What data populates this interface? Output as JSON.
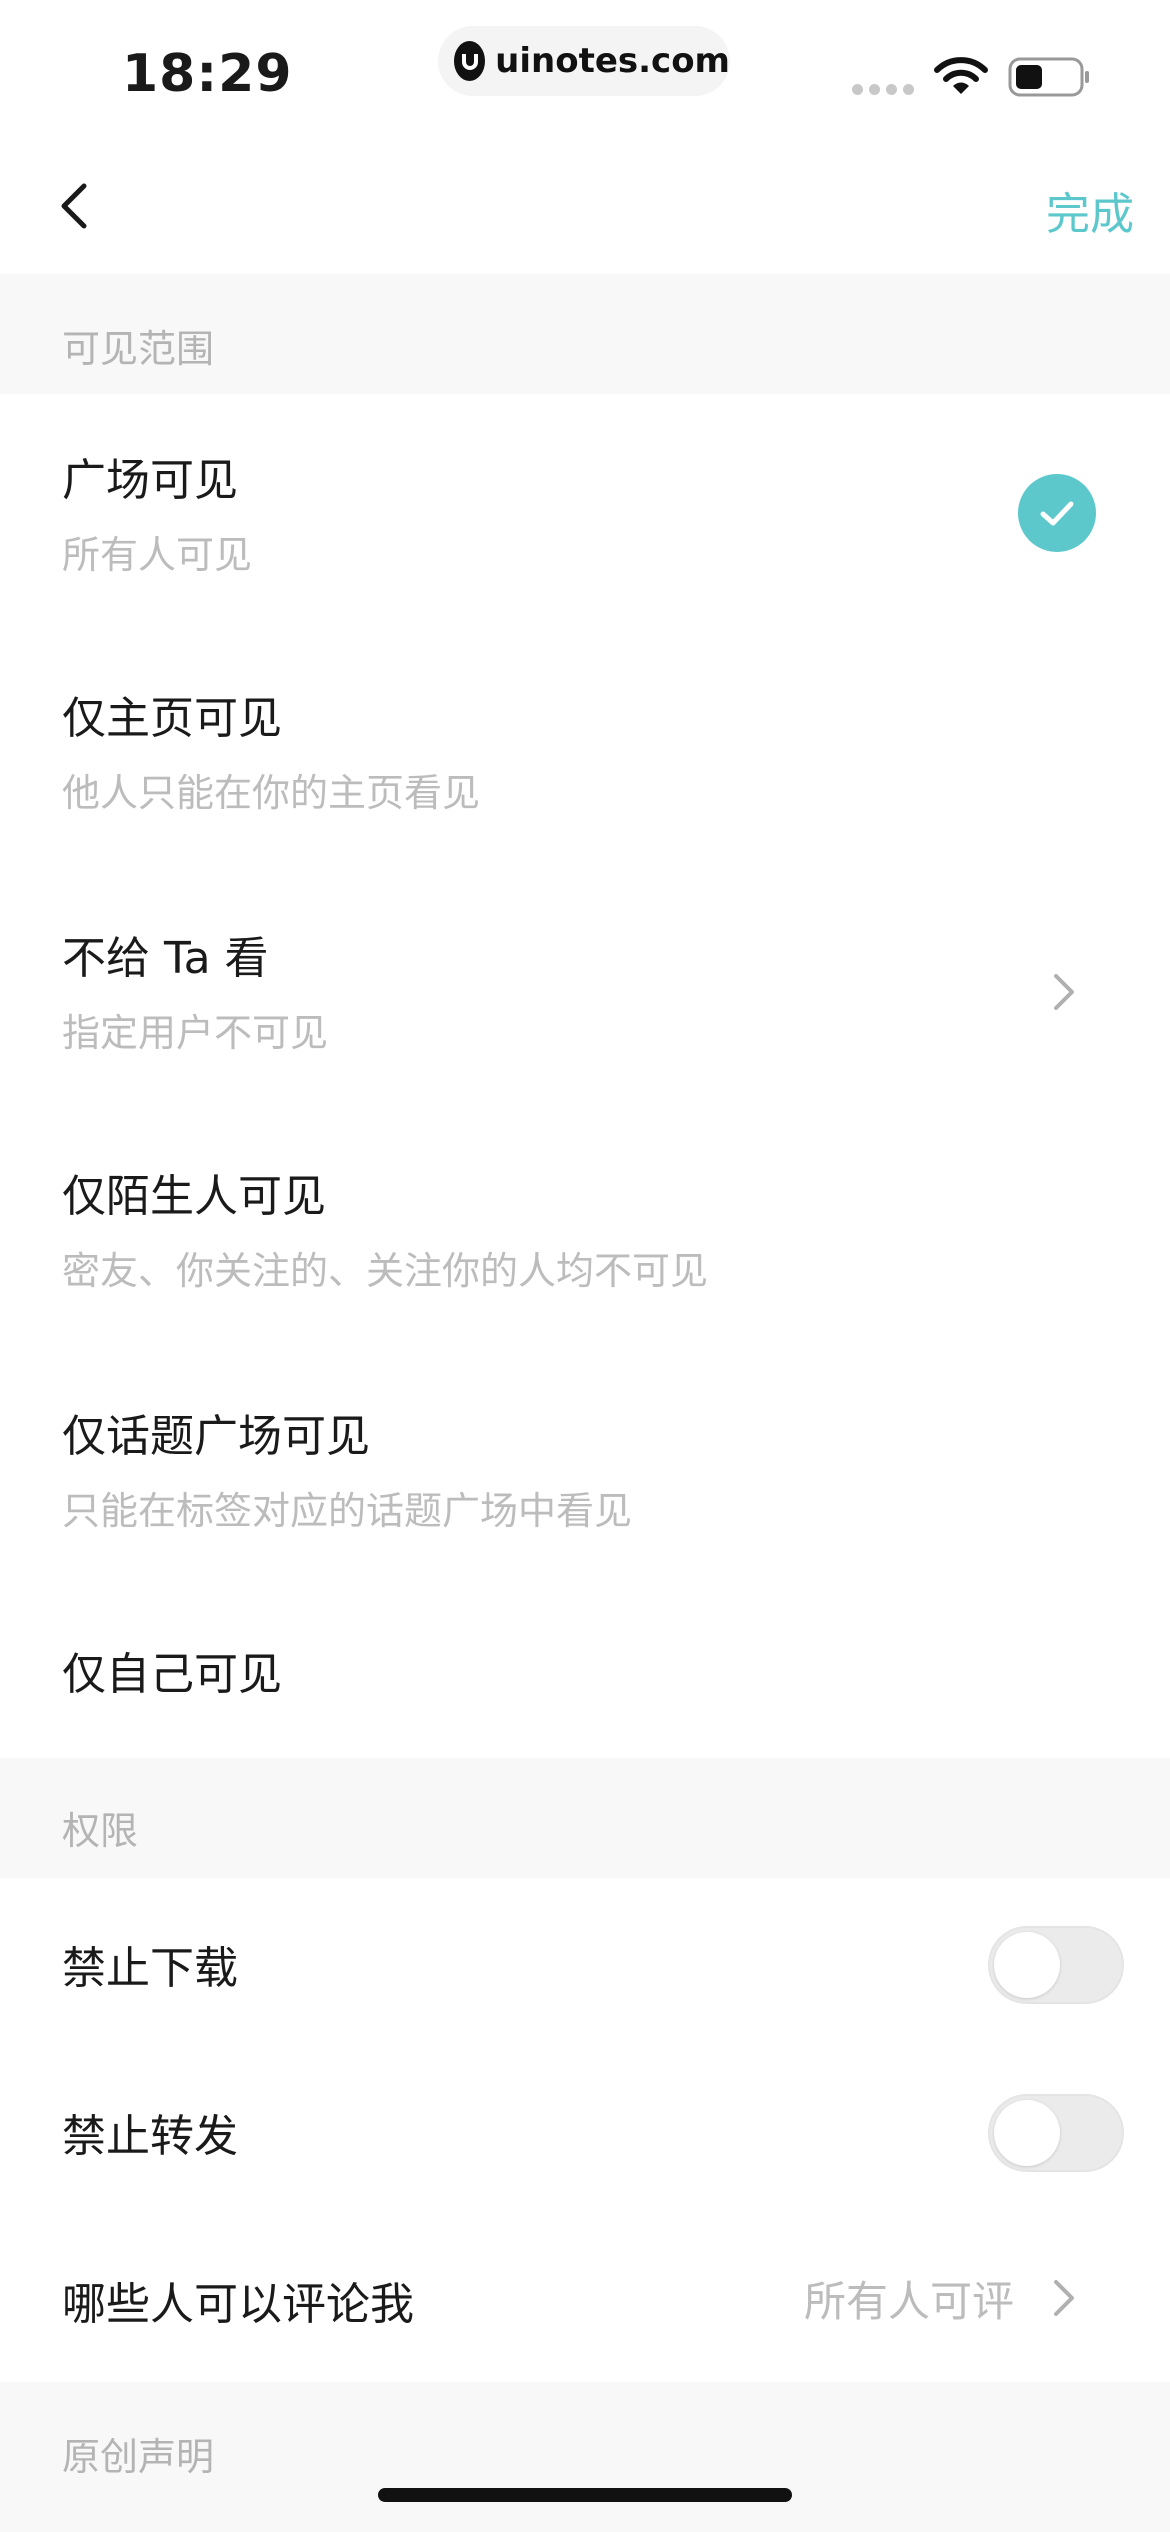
{
  "status_bar": {
    "time": "18:29",
    "url": "uinotes.com"
  },
  "nav": {
    "back_icon": "chevron-left-icon",
    "done_label": "完成",
    "accent_color": "#5cc8cc"
  },
  "visibility_section": {
    "header": "可见范围",
    "options": [
      {
        "title": "广场可见",
        "subtitle": "所有人可见",
        "selected": true
      },
      {
        "title": "仅主页可见",
        "subtitle": "他人只能在你的主页看见",
        "selected": false
      },
      {
        "title": "不给 Ta 看",
        "subtitle": "指定用户不可见",
        "selected": false,
        "has_chevron": true
      },
      {
        "title": "仅陌生人可见",
        "subtitle": "密友、你关注的、关注你的人均不可见",
        "selected": false
      },
      {
        "title": "仅话题广场可见",
        "subtitle": "只能在标签对应的话题广场中看见",
        "selected": false
      },
      {
        "title": "仅自己可见",
        "subtitle": "",
        "selected": false
      }
    ]
  },
  "permissions_section": {
    "header": "权限",
    "items": [
      {
        "label": "禁止下载",
        "toggle_on": false
      },
      {
        "label": "禁止转发",
        "toggle_on": false
      },
      {
        "label": "哪些人可以评论我",
        "value": "所有人可评"
      }
    ]
  },
  "original_section": {
    "header": "原创声明"
  }
}
